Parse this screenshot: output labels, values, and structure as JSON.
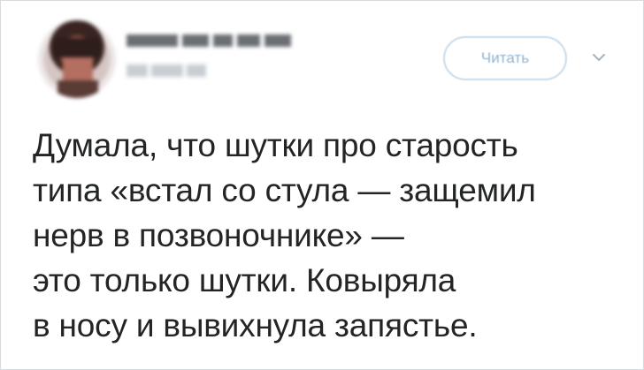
{
  "header": {
    "follow_label": "Читать",
    "avatar_icon": "avatar-blurred",
    "menu_icon": "chevron-down-icon"
  },
  "tweet": {
    "lines": [
      "Думала, что шутки про старость",
      "типа «встал со стула — защемил",
      "нерв в позвоночнике» —",
      "это только шутки. Ковыряла",
      "в носу и вывихнула запястье."
    ]
  },
  "colors": {
    "text": "#222426",
    "border": "#d7dbde",
    "follow_text": "#8fb3cf",
    "follow_border": "#c9dbe9"
  }
}
